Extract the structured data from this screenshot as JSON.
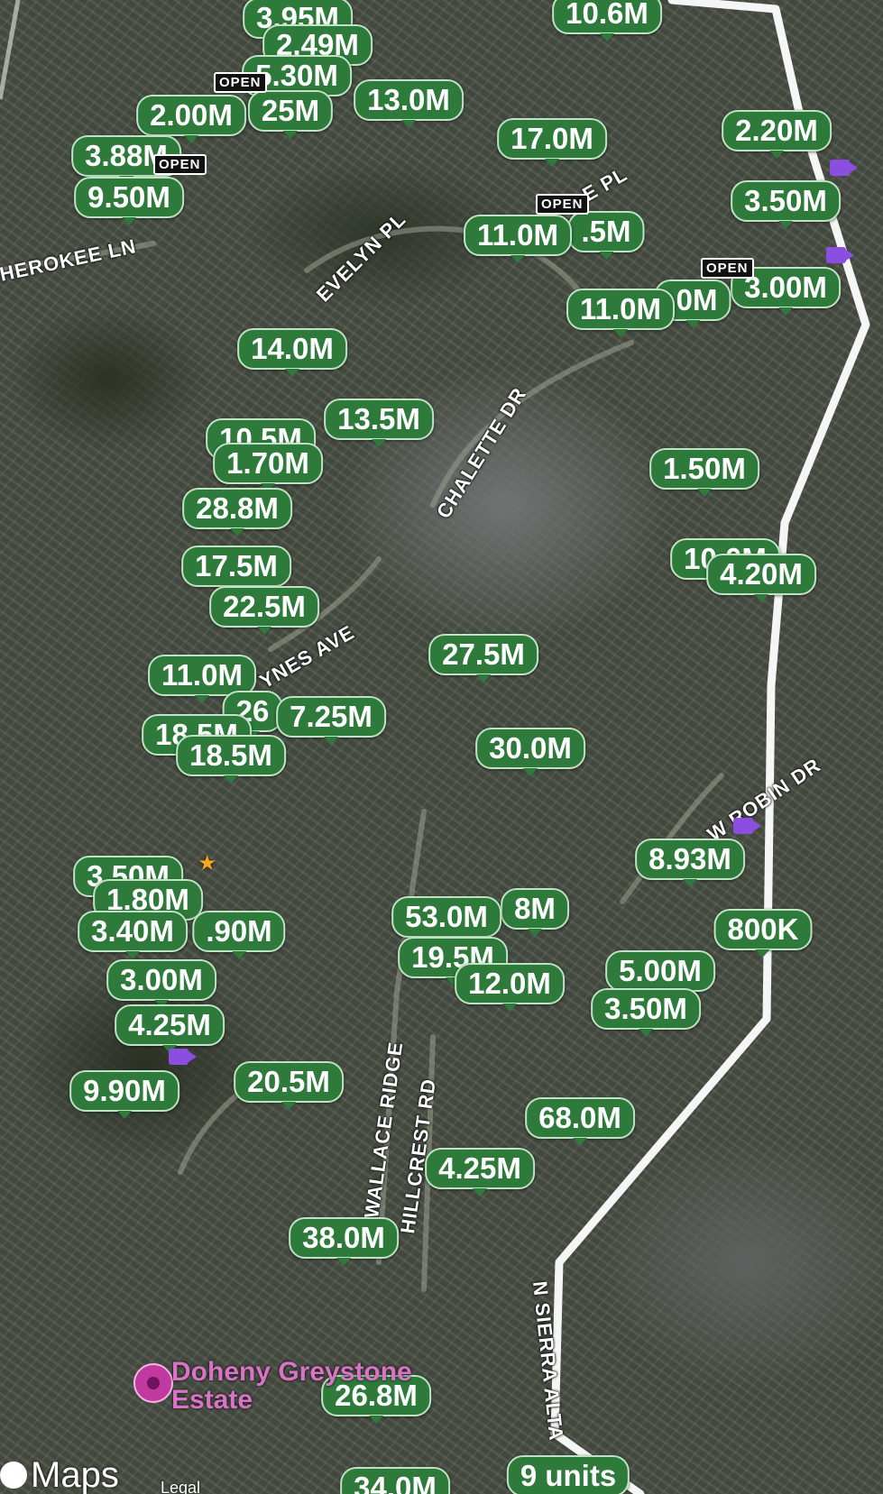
{
  "map": {
    "roads": [
      "HEROKEE LN",
      "EVELYN PL",
      "CHALETTE DR",
      "YNES AVE",
      "W ROBIN DR",
      "WALLACE RIDGE",
      "HILLCREST RD",
      "N SIERRA ALTA",
      "E PL"
    ],
    "price_pins": [
      "3.95M",
      "2.49M",
      "5.30M",
      "10.6M",
      "13.0M",
      "2.00M",
      "25M",
      "17.0M",
      "2.20M",
      "3.88M",
      "3.50M",
      "9.50M",
      "11.0M",
      ".5M",
      "11.0M",
      ".0M",
      "3.00M",
      "14.0M",
      "13.5M",
      "10.5M",
      "1.70M",
      "1.50M",
      "28.8M",
      "17.5M",
      "10.0M",
      "4.20M",
      "22.5M",
      "27.5M",
      "11.0M",
      "26",
      "7.25M",
      "18.5M",
      "18.5M",
      "30.0M",
      "8.93M",
      "3.50M",
      "1.80M",
      "53.0M",
      "8M",
      "800K",
      "3.40M",
      ".90M",
      "19.5M",
      "5.00M",
      "3.00M",
      "12.0M",
      "3.50M",
      "4.25M",
      "20.5M",
      "9.90M",
      "68.0M",
      "4.25M",
      "38.0M",
      "26.8M",
      "9 units",
      "34.0M"
    ],
    "open_badge": "OPEN",
    "poi": {
      "name": "Doheny Greystone Estate",
      "icon": "location-pin-icon"
    },
    "attribution": {
      "logo": "Maps",
      "legal": "Legal"
    },
    "colors": {
      "pin_green": "#2d7a3b",
      "poi_pink": "#d873c6",
      "video_purple": "#8a4fe0"
    }
  }
}
